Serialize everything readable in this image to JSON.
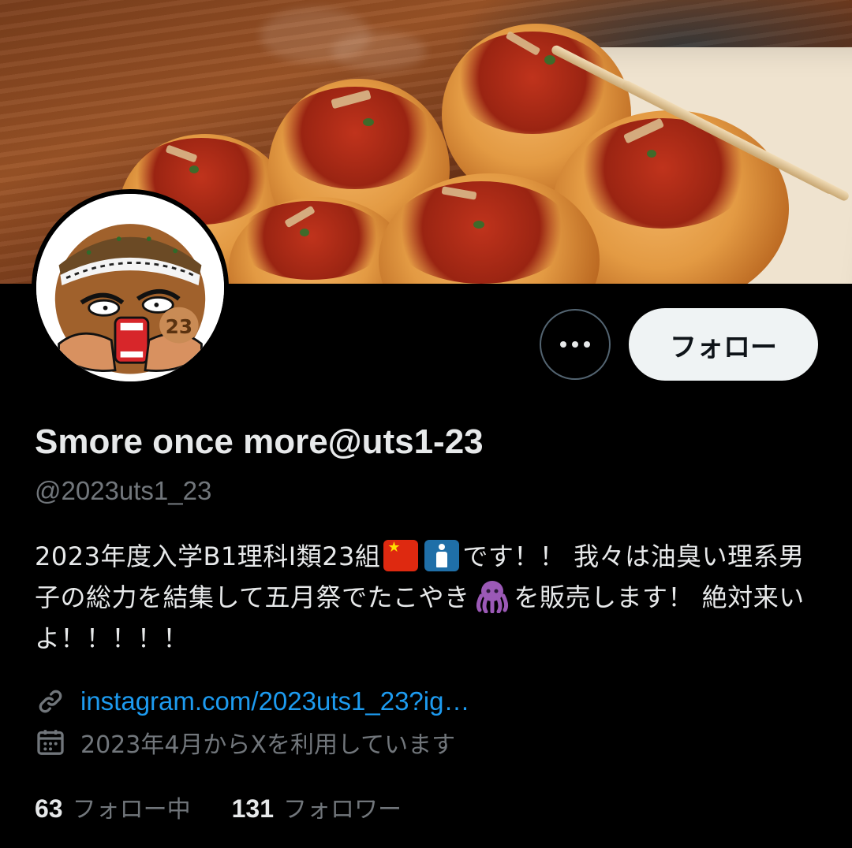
{
  "profile": {
    "display_name": "Smore once more@uts1-23",
    "handle": "@2023uts1_23",
    "bio": {
      "part1": "2023年度入学B1理科I類23組",
      "part2": "です！！ 我々は油臭い理系男子の総力を結集して五月祭でたこやき",
      "part3": "を販売します！ 絶対来いよ！！！！！"
    },
    "link": "instagram.com/2023uts1_23?ig…",
    "joined": "2023年4月からXを利用しています",
    "avatar_badge": "23"
  },
  "actions": {
    "follow_label": "フォロー",
    "more_icon": "more-horizontal-icon"
  },
  "stats": {
    "following_count": "63",
    "following_label": "フォロー中",
    "followers_count": "131",
    "followers_label": "フォロワー"
  },
  "icons": {
    "link": "link-icon",
    "calendar": "calendar-icon",
    "flag": "china-flag-icon",
    "man": "mens-room-icon",
    "octopus": "octopus-icon"
  },
  "colors": {
    "background": "#000000",
    "text_primary": "#e7e9ea",
    "text_secondary": "#71767b",
    "link": "#1d9bf0",
    "follow_button_bg": "#eff3f4"
  }
}
